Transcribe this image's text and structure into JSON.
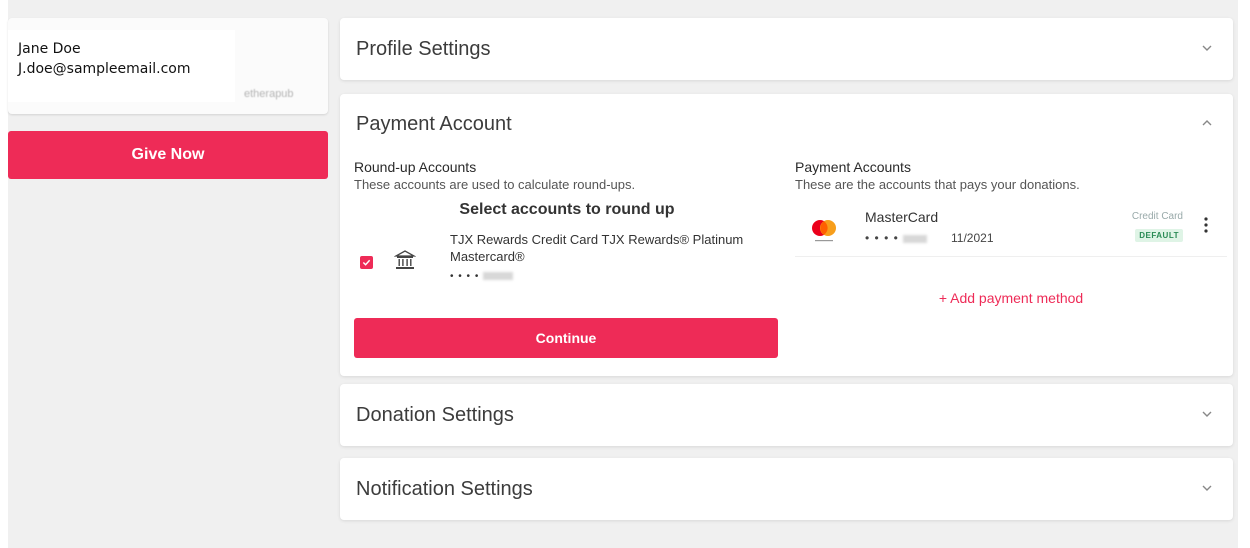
{
  "profile": {
    "name": "Jane Doe",
    "email": "J.doe@sampleemail.com",
    "blurred_text": "etherapub"
  },
  "sidebar": {
    "give_now_label": "Give Now"
  },
  "panels": {
    "profile_settings": {
      "title": "Profile Settings",
      "expanded": false
    },
    "payment_account": {
      "title": "Payment Account",
      "expanded": true,
      "roundup": {
        "title": "Round-up Accounts",
        "subtitle": "These accounts are used to calculate round-ups.",
        "select_title": "Select accounts to round up",
        "accounts": [
          {
            "name": "TJX Rewards Credit Card TJX Rewards® Platinum Mastercard®",
            "mask": "• • • •",
            "checked": true
          }
        ],
        "continue_label": "Continue"
      },
      "payment": {
        "title": "Payment Accounts",
        "subtitle": "These are the accounts that pays your donations.",
        "methods": [
          {
            "name": "MasterCard",
            "mask": "• • • •",
            "expiry": "11/2021",
            "type": "Credit Card",
            "badge": "DEFAULT"
          }
        ],
        "add_label": "+ Add payment method"
      }
    },
    "donation_settings": {
      "title": "Donation Settings",
      "expanded": false
    },
    "notification_settings": {
      "title": "Notification Settings",
      "expanded": false
    }
  },
  "colors": {
    "accent": "#ee2b57",
    "background": "#f0f0f0",
    "card": "#ffffff",
    "default_badge_bg": "#dff4e6",
    "default_badge_text": "#2a8b55"
  }
}
